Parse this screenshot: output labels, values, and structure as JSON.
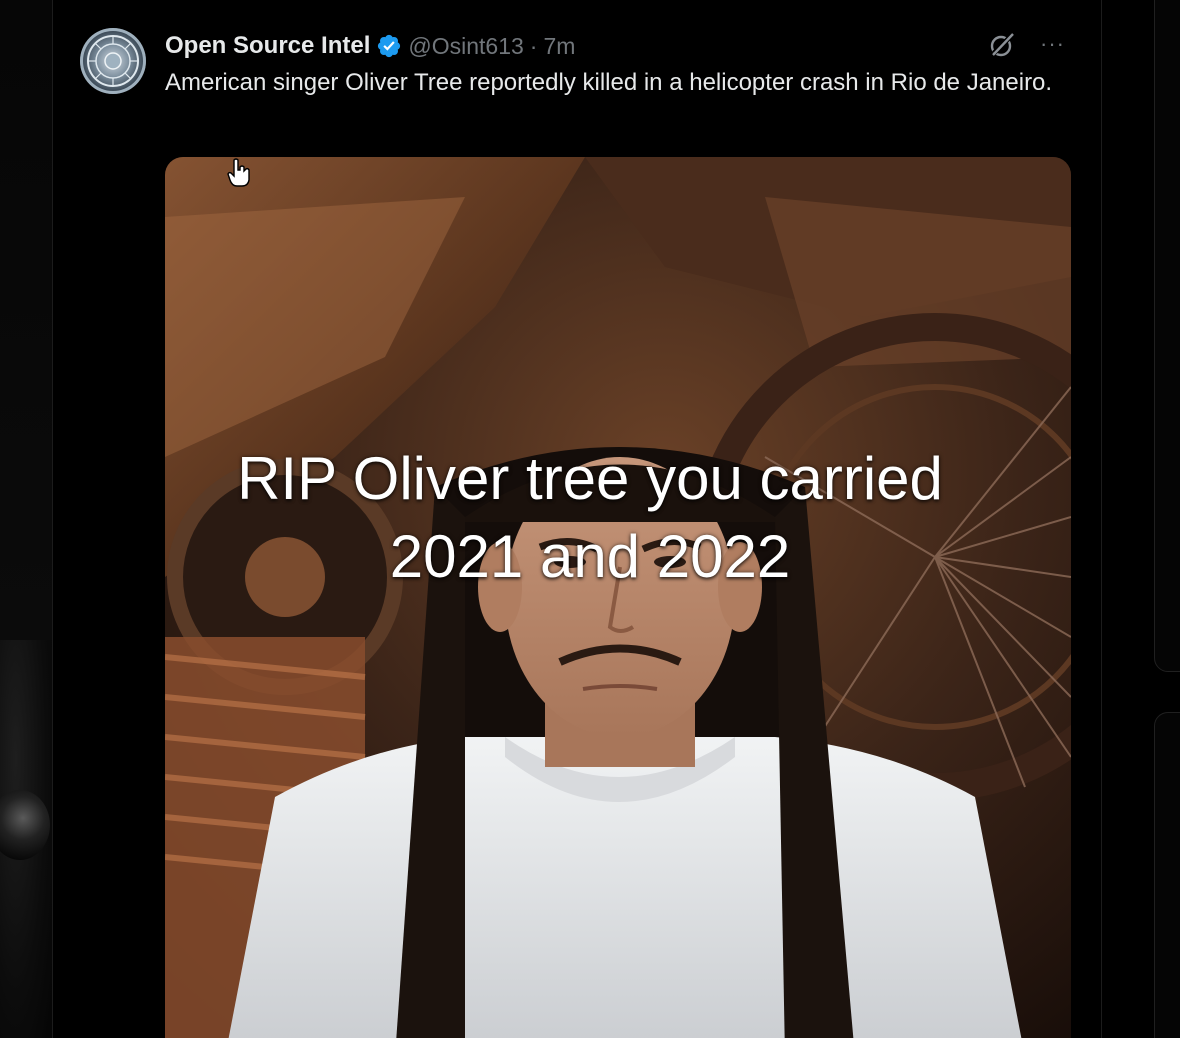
{
  "tweet": {
    "display_name": "Open Source Intel",
    "handle": "@Osint613",
    "separator": "·",
    "time": "7m",
    "text": "American singer Oliver Tree reportedly killed in a helicopter crash in Rio de Janeiro.",
    "more_label": "···"
  },
  "overlay": {
    "line1": "RIP Oliver tree you carried",
    "line2": "2021 and 2022"
  },
  "icons": {
    "avatar": "avatar-emblem-icon",
    "verified": "verified-badge-icon",
    "grok": "grok-icon",
    "more": "more-options-icon",
    "cursor": "hand-pointer-icon"
  },
  "colors": {
    "verified": "#1d9bf0",
    "text_primary": "#e7e9ea",
    "text_secondary": "#71767b",
    "background": "#000000"
  }
}
